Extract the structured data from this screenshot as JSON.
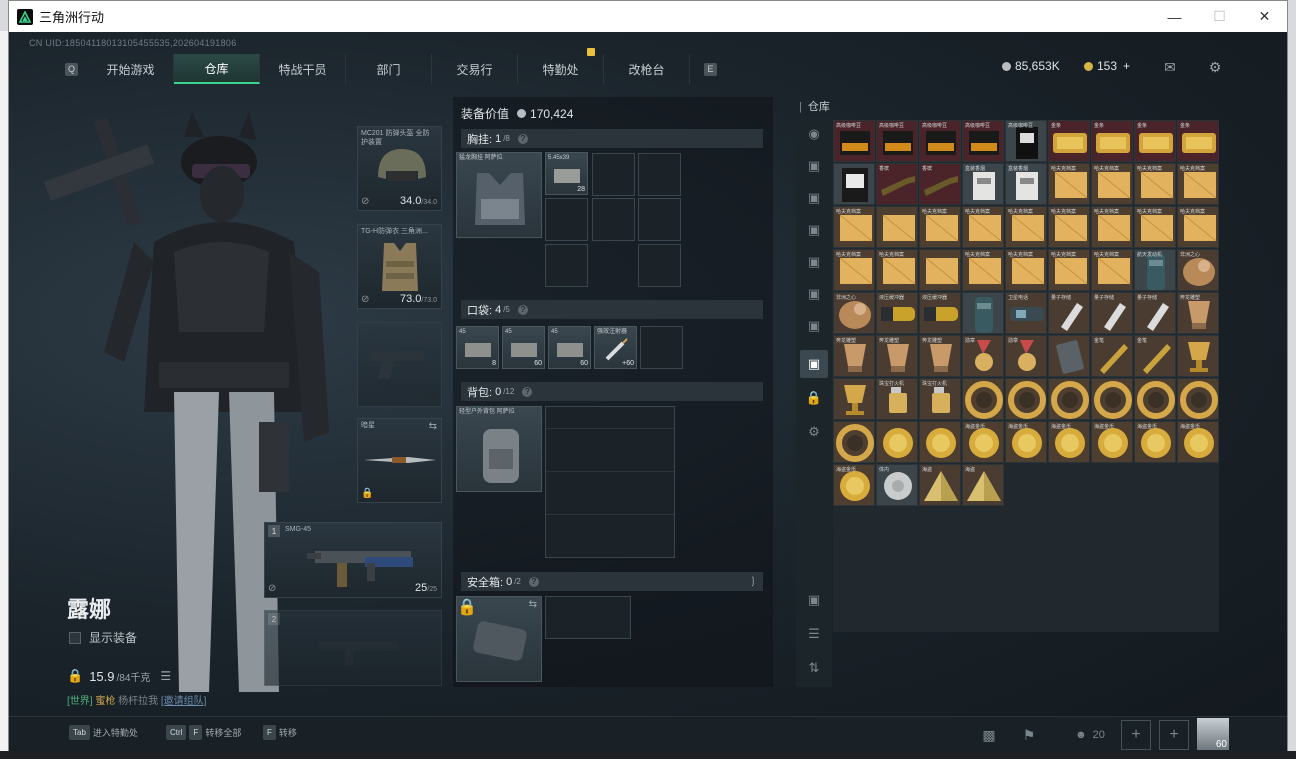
{
  "window": {
    "title": "三角洲行动"
  },
  "header": {
    "uid": "CN UID:1850411801310545553​5,202604191806",
    "tabs": [
      "开始游戏",
      "仓库",
      "特战干员",
      "部门",
      "交易行",
      "特勤处",
      "改枪台"
    ],
    "active_tab": "仓库",
    "silver": "85,653K",
    "gold": "153",
    "gold_plus": "+"
  },
  "character": {
    "name": "露娜",
    "show_equipment": "显示装备",
    "weight": "15.9",
    "weight_max": "/84千克",
    "chat_channel": "[世界]",
    "chat_user": "蜜枪",
    "chat_text": "杨杆拉我",
    "chat_link": "[邀请组队]"
  },
  "equipment": {
    "helmet": {
      "label": "MC201 防弹头盔 全防护装置",
      "durability": "34.0",
      "max": "/34.0"
    },
    "armor": {
      "label": "TG-H防弹衣 三角洲...",
      "durability": "73.0",
      "max": "/73.0"
    },
    "melee": {
      "label": "暗星"
    },
    "primary": {
      "label": "SMG-45",
      "ammo": "25",
      "ammo_max": "/25",
      "slot": "1"
    },
    "secondary": {
      "slot": "2"
    }
  },
  "loadout": {
    "value_label": "装备价值",
    "value": "170,424",
    "chest": {
      "label": "胸挂:",
      "used": "1",
      "cap": "/8",
      "item": "猛龙胸挂 阿萨拉"
    },
    "chest_ammo": {
      "label": "5.45x39",
      "count": "28"
    },
    "pocket": {
      "label": "口袋:",
      "used": "4",
      "cap": "/5",
      "items": [
        {
          "label": "45",
          "count": "8"
        },
        {
          "label": "45",
          "count": "60"
        },
        {
          "label": "45",
          "count": "60"
        },
        {
          "label": "强效注射器",
          "count": "+60"
        }
      ]
    },
    "backpack": {
      "label": "背包:",
      "used": "0",
      "cap": "/12",
      "item": "轻型户外背包 阿萨拉"
    },
    "safebox": {
      "label": "安全箱:",
      "used": "0",
      "cap": "/2"
    }
  },
  "warehouse": {
    "title": "仓库",
    "items": [
      {
        "name": "高级咖啡豆",
        "kind": "coffee"
      },
      {
        "name": "高级咖啡豆",
        "kind": "coffee"
      },
      {
        "name": "高级咖啡豆",
        "kind": "coffee"
      },
      {
        "name": "高级咖啡豆",
        "kind": "coffee"
      },
      {
        "name": "高级咖啡豆",
        "kind": "bag"
      },
      {
        "name": "金条",
        "kind": "gold"
      },
      {
        "name": "金条",
        "kind": "gold"
      },
      {
        "name": "金条",
        "kind": "gold"
      },
      {
        "name": "金条",
        "kind": "gold"
      },
      {
        "name": "",
        "kind": "bag2"
      },
      {
        "name": "香槟",
        "kind": "bottle"
      },
      {
        "name": "香槟",
        "kind": "bottle"
      },
      {
        "name": "盒装香烟",
        "kind": "box"
      },
      {
        "name": "盒装香烟",
        "kind": "box"
      },
      {
        "name": "哈夫克档案",
        "kind": "doc"
      },
      {
        "name": "哈夫克档案",
        "kind": "doc"
      },
      {
        "name": "哈夫克档案",
        "kind": "doc"
      },
      {
        "name": "哈夫克档案",
        "kind": "doc"
      },
      {
        "name": "哈夫克档案",
        "kind": "doc"
      },
      {
        "name": "",
        "kind": "doc"
      },
      {
        "name": "哈夫克档案",
        "kind": "doc"
      },
      {
        "name": "哈夫克档案",
        "kind": "doc"
      },
      {
        "name": "哈夫克档案",
        "kind": "doc"
      },
      {
        "name": "哈夫克档案",
        "kind": "doc"
      },
      {
        "name": "哈夫克档案",
        "kind": "doc"
      },
      {
        "name": "哈夫克档案",
        "kind": "doc"
      },
      {
        "name": "哈夫克档案",
        "kind": "doc"
      },
      {
        "name": "哈夫克档案",
        "kind": "doc"
      },
      {
        "name": "哈夫克档案",
        "kind": "doc"
      },
      {
        "name": "",
        "kind": "doc"
      },
      {
        "name": "哈夫克档案",
        "kind": "doc"
      },
      {
        "name": "哈夫克档案",
        "kind": "doc"
      },
      {
        "name": "哈夫克档案",
        "kind": "doc"
      },
      {
        "name": "哈夫克档案",
        "kind": "doc"
      },
      {
        "name": "航天发动机",
        "kind": "canister"
      },
      {
        "name": "非洲之心",
        "kind": "figure"
      },
      {
        "name": "非洲之心",
        "kind": "figure"
      },
      {
        "name": "液压缓冲器",
        "kind": "cylinder"
      },
      {
        "name": "液压缓冲器",
        "kind": "cylinder"
      },
      {
        "name": "",
        "kind": "canister"
      },
      {
        "name": "卫星电话",
        "kind": "phone"
      },
      {
        "name": "量子存储",
        "kind": "usb"
      },
      {
        "name": "量子存储",
        "kind": "usb"
      },
      {
        "name": "量子存储",
        "kind": "usb"
      },
      {
        "name": "奔龙雕塑",
        "kind": "cup"
      },
      {
        "name": "奔龙雕塑",
        "kind": "cup"
      },
      {
        "name": "奔龙雕塑",
        "kind": "cup"
      },
      {
        "name": "奔龙雕塑",
        "kind": "cup"
      },
      {
        "name": "勋章",
        "kind": "medal"
      },
      {
        "name": "勋章",
        "kind": "medal"
      },
      {
        "name": "",
        "kind": "card"
      },
      {
        "name": "金笔",
        "kind": "pen"
      },
      {
        "name": "金笔",
        "kind": "pen"
      },
      {
        "name": "",
        "kind": "goblet"
      },
      {
        "name": "",
        "kind": "goblet"
      },
      {
        "name": "珠宝打火机",
        "kind": "lighter"
      },
      {
        "name": "珠宝打火机",
        "kind": "lighter"
      },
      {
        "name": "",
        "kind": "ring"
      },
      {
        "name": "",
        "kind": "ring"
      },
      {
        "name": "",
        "kind": "ring"
      },
      {
        "name": "",
        "kind": "ring"
      },
      {
        "name": "",
        "kind": "ring"
      },
      {
        "name": "",
        "kind": "ring"
      },
      {
        "name": "",
        "kind": "ring"
      },
      {
        "name": "",
        "kind": "coin"
      },
      {
        "name": "",
        "kind": "coin"
      },
      {
        "name": "海盗金币",
        "kind": "coin"
      },
      {
        "name": "海盗金币",
        "kind": "coin"
      },
      {
        "name": "海盗金币",
        "kind": "coin"
      },
      {
        "name": "海盗金币",
        "kind": "coin"
      },
      {
        "name": "海盗金币",
        "kind": "coin"
      },
      {
        "name": "海盗金币",
        "kind": "coin"
      },
      {
        "name": "海盗金币",
        "kind": "coin"
      },
      {
        "name": "体内",
        "kind": "plate"
      },
      {
        "name": "海盗",
        "kind": "pyramid"
      },
      {
        "name": "海盗",
        "kind": "pyramid"
      }
    ]
  },
  "bottombar": {
    "tab_key": "Tab",
    "tab_label": "进入特勤处",
    "ctrl_key": "Ctrl",
    "f_key": "F",
    "transfer_all": "转移全部",
    "f2_key": "F",
    "transfer": "转移",
    "friends": "20",
    "level": "60"
  }
}
